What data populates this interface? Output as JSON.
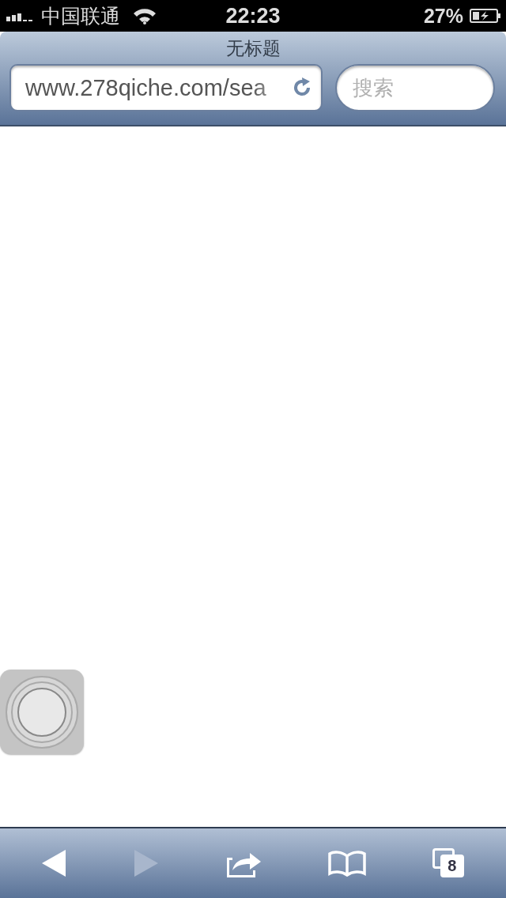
{
  "status_bar": {
    "carrier": "中国联通",
    "time": "22:23",
    "battery": "27%"
  },
  "title": "无标题",
  "url_field": {
    "value": "www.278qiche.com/sea"
  },
  "search_field": {
    "placeholder": "搜索"
  },
  "toolbar": [
    {
      "kind": "back",
      "disabled": false
    },
    {
      "kind": "forward",
      "disabled": true
    },
    {
      "kind": "share",
      "disabled": false
    },
    {
      "kind": "bookmarks",
      "disabled": false
    },
    {
      "kind": "tabs",
      "disabled": false,
      "count": "8"
    }
  ]
}
